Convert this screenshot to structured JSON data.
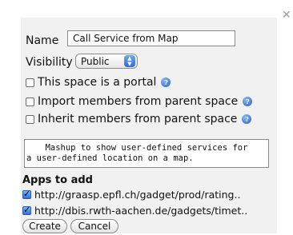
{
  "dialog": {
    "close_glyph": "✕",
    "name_label": "Name",
    "name_value": "Call Service from Map",
    "visibility_label": "Visibility",
    "visibility_value": "Public",
    "options": [
      {
        "label": "This space is a portal",
        "checked": false
      },
      {
        "label": "Import members from parent space",
        "checked": false
      },
      {
        "label": "Inherit members from parent space",
        "checked": false
      }
    ],
    "description_line1": "Mashup to show user-defined services for",
    "description_line2": "a user-defined location on a map.",
    "apps_title": "Apps to add",
    "apps": [
      {
        "url": "http://graasp.epfl.ch/gadget/prod/rating..",
        "checked": true
      },
      {
        "url": "http://dbis.rwth-aachen.de/gadgets/timet..",
        "checked": true
      }
    ],
    "create_label": "Create",
    "cancel_label": "Cancel",
    "help_glyph": "?",
    "accent_color": "#2d6ed4"
  }
}
